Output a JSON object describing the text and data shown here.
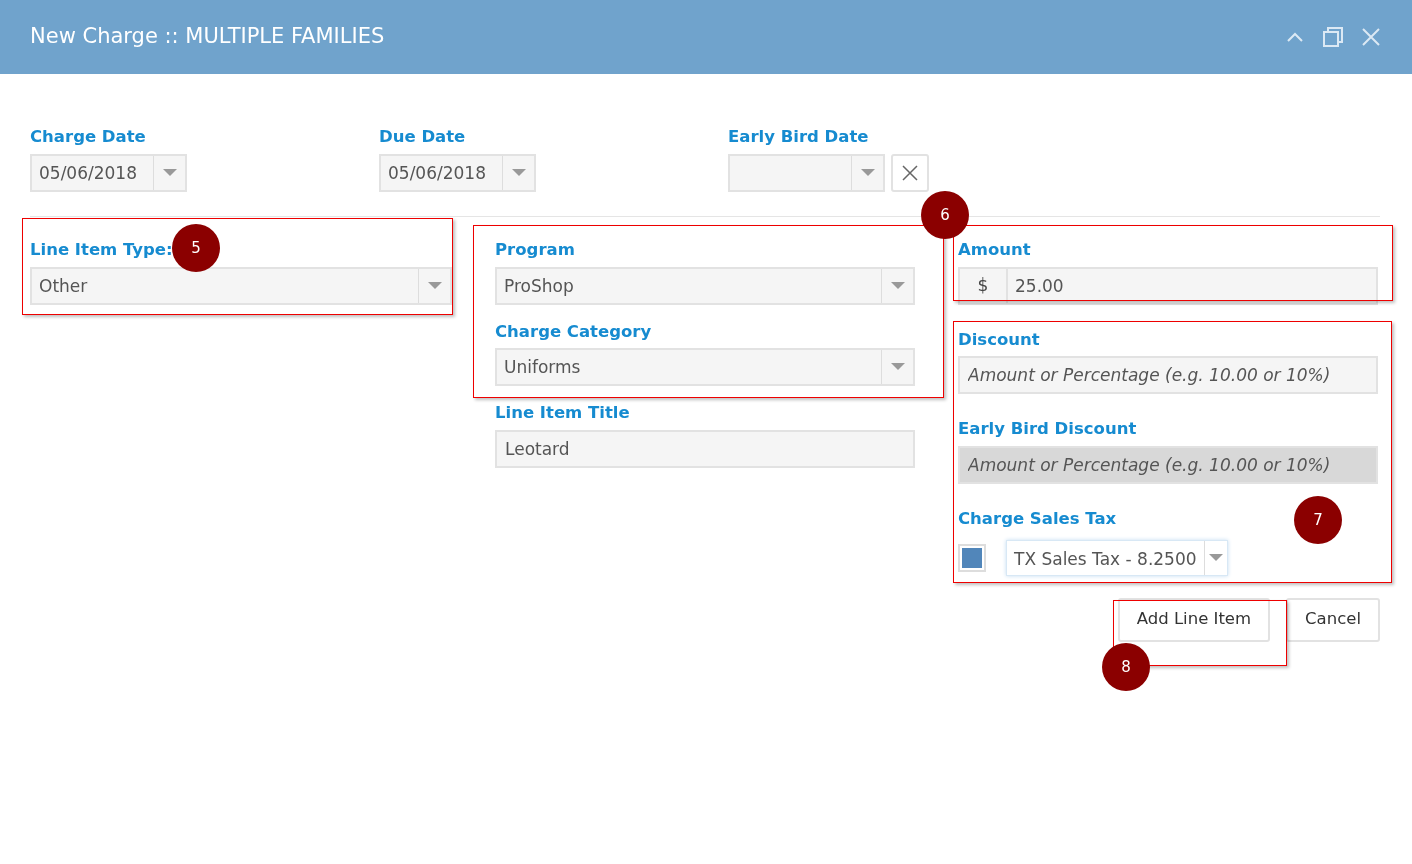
{
  "window": {
    "title": "New Charge :: MULTIPLE FAMILIES"
  },
  "dates": [
    {
      "label": "Charge Date",
      "value": "05/06/2018",
      "clearable": false
    },
    {
      "label": "Due Date",
      "value": "05/06/2018",
      "clearable": false
    },
    {
      "label": "Early Bird Date",
      "clearable": true
    }
  ],
  "line_item_type": {
    "label": "Line Item Type:",
    "value": "Other"
  },
  "program": {
    "label": "Program",
    "value": "ProShop"
  },
  "charge_category": {
    "label": "Charge Category",
    "value": "Uniforms"
  },
  "line_item_title": {
    "label": "Line Item Title",
    "value": "Leotard"
  },
  "amount": {
    "label": "Amount",
    "prefix": "$",
    "value": "25.00"
  },
  "discount": {
    "label": "Discount",
    "placeholder": "Amount or Percentage (e.g. 10.00 or 10%)",
    "disabled": false
  },
  "early_bird_discount": {
    "label": "Early Bird Discount",
    "placeholder": "Amount or Percentage (e.g. 10.00 or 10%)",
    "disabled": true
  },
  "sales_tax": {
    "label": "Charge Sales Tax",
    "checked": true,
    "value": "TX Sales Tax - 8.2500"
  },
  "buttons": [
    "Add Line Item",
    "Cancel"
  ],
  "callouts": [
    {
      "number": "5"
    },
    {
      "number": "6"
    },
    {
      "number": "7"
    },
    {
      "number": "8"
    }
  ]
}
